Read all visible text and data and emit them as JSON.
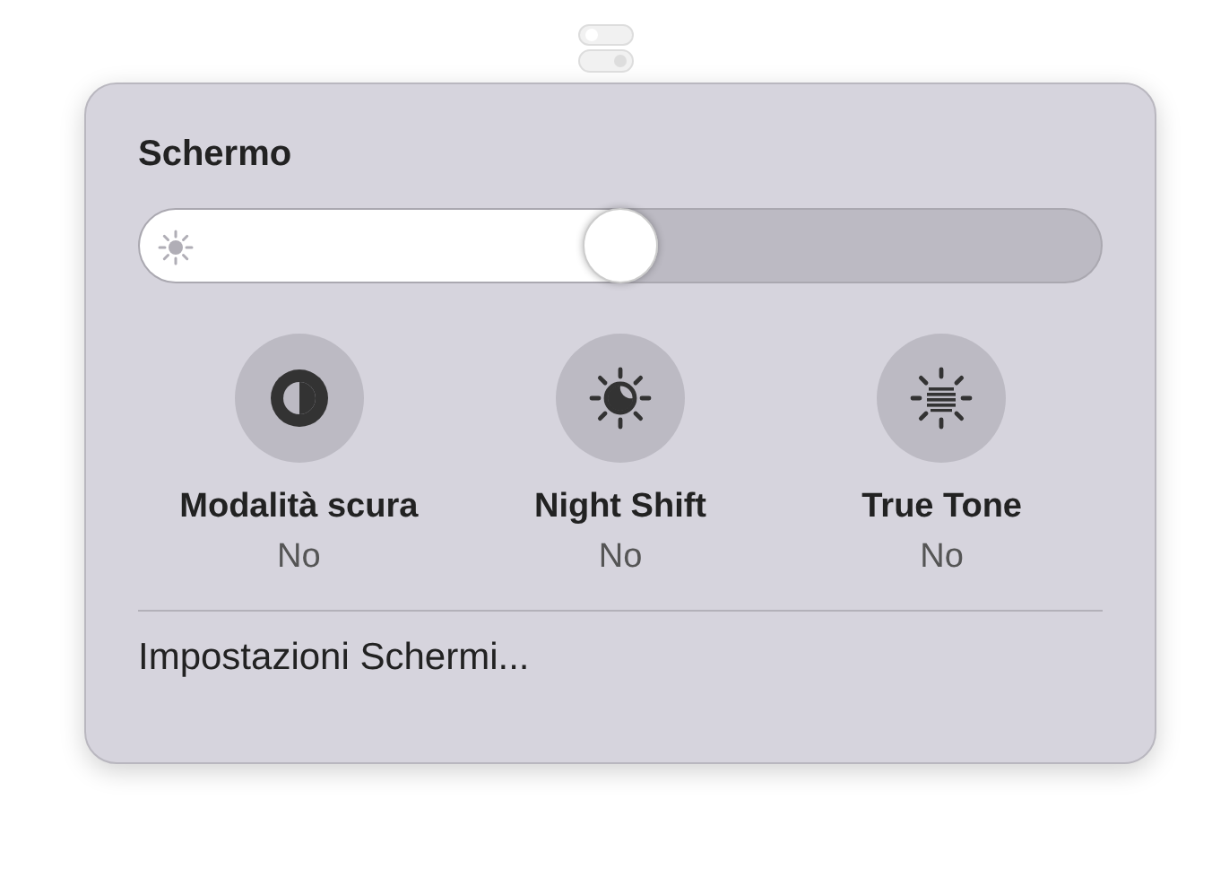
{
  "panel": {
    "title": "Schermo"
  },
  "brightness": {
    "level": 0.5
  },
  "toggles": [
    {
      "kind": "dark-mode",
      "label": "Modalità scura",
      "status": "No",
      "on": false
    },
    {
      "kind": "night-shift",
      "label": "Night Shift",
      "status": "No",
      "on": false
    },
    {
      "kind": "true-tone",
      "label": "True Tone",
      "status": "No",
      "on": false
    }
  ],
  "settings_link": "Impostazioni Schermi..."
}
